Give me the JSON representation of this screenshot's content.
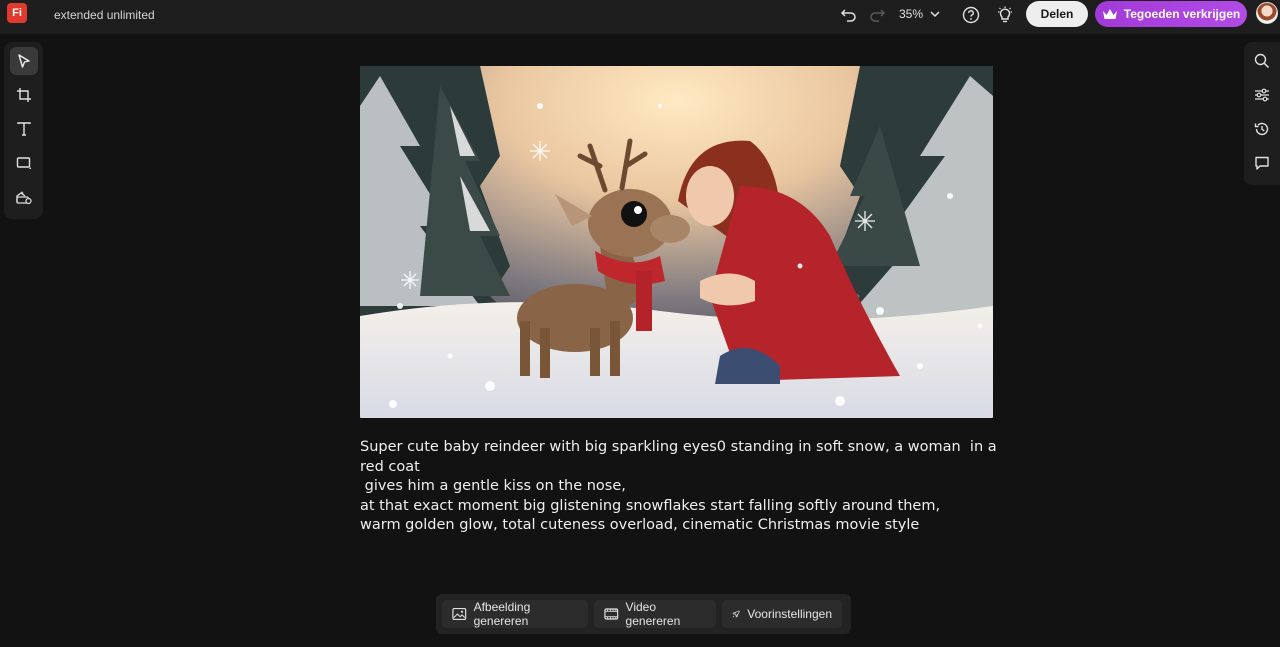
{
  "app": {
    "logo_text": "Fi",
    "doc_title": "extended unlimited",
    "brand_color": "#e03a2f"
  },
  "header": {
    "zoom": "35%",
    "share_label": "Delen",
    "credits_label": "Tegoeden verkrijgen",
    "credits_color": "#a23ad8"
  },
  "left_toolbar": {
    "tools": [
      "select-icon",
      "crop-icon",
      "text-icon",
      "shape-icon",
      "generate-assets-icon"
    ]
  },
  "right_toolbar": {
    "tools": [
      "search-icon",
      "adjustments-icon",
      "history-icon",
      "comments-icon"
    ]
  },
  "canvas": {
    "prompt": "Super cute baby reindeer with big sparkling eyes0 standing in soft snow, a woman  in a red coat\n gives him a gentle kiss on the nose,\nat that exact moment big glistening snowflakes start falling softly around them,\nwarm golden glow, total cuteness overload, cinematic Christmas movie style"
  },
  "bottom_bar": {
    "generate_image_label": "Afbeelding genereren",
    "generate_video_label": "Video genereren",
    "presets_label": "Voorinstellingen"
  }
}
